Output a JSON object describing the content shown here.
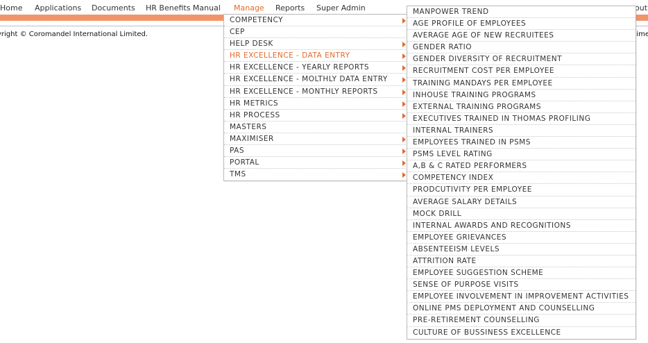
{
  "nav": {
    "items": [
      "Home",
      "Applications",
      "Documents",
      "HR Benefits Manual",
      "Manage",
      "Reports",
      "Super Admin"
    ],
    "active": "Manage",
    "right_fragment": "out"
  },
  "footer": {
    "copyright": "yright © Coromandel International Limited.",
    "right_fragment": "time"
  },
  "manage_menu": [
    {
      "label": "COMPETENCY",
      "arrow": true
    },
    {
      "label": "CEP",
      "arrow": false
    },
    {
      "label": "HELP DESK",
      "arrow": true
    },
    {
      "label": "HR EXCELLENCE - DATA ENTRY",
      "arrow": true,
      "highlight": true
    },
    {
      "label": "HR EXCELLENCE - YEARLY REPORTS",
      "arrow": true
    },
    {
      "label": "HR EXCELLENCE - MOLTHLY DATA ENTRY",
      "arrow": true
    },
    {
      "label": "HR EXCELLENCE - MONTHLY REPORTS",
      "arrow": true
    },
    {
      "label": "HR METRICS",
      "arrow": true
    },
    {
      "label": "HR PROCESS",
      "arrow": true
    },
    {
      "label": "MASTERS",
      "arrow": false
    },
    {
      "label": "MAXIMISER",
      "arrow": true
    },
    {
      "label": "PAS",
      "arrow": true
    },
    {
      "label": "PORTAL",
      "arrow": true
    },
    {
      "label": "TMS",
      "arrow": true
    }
  ],
  "submenu": [
    "MANPOWER TREND",
    "AGE PROFILE OF EMPLOYEES",
    "AVERAGE AGE OF NEW RECRUITEES",
    "GENDER RATIO",
    "GENDER DIVERSITY OF RECRUITMENT",
    "RECRUITMENT COST PER EMPLOYEE",
    "TRAINING MANDAYS PER EMPLOYEE",
    "INHOUSE TRAINING PROGRAMS",
    "EXTERNAL TRAINING PROGRAMS",
    "EXECUTIVES TRAINED IN THOMAS PROFILING",
    "INTERNAL TRAINERS",
    "EMPLOYEES TRAINED IN PSMS",
    "PSMS LEVEL RATING",
    "A,B & C RATED PERFORMERS",
    "COMPETENCY INDEX",
    "PRODCUTIVITY PER EMPLOYEE",
    "AVERAGE SALARY DETAILS",
    "MOCK DRILL",
    "INTERNAL AWARDS AND RECOGNITIONS",
    "EMPLOYEE GRIEVANCES",
    "ABSENTEEISM LEVELS",
    "ATTRITION RATE",
    "EMPLOYEE SUGGESTION SCHEME",
    "SENSE OF PURPOSE VISITS",
    "EMPLOYEE INVOLVEMENT IN IMPROVEMENT ACTIVITIES",
    "ONLINE PMS DEPLOYMENT AND COUNSELLING",
    "PRE-RETIREMENT COUNSELLING",
    "CULTURE OF BUSSINESS EXCELLENCE"
  ]
}
